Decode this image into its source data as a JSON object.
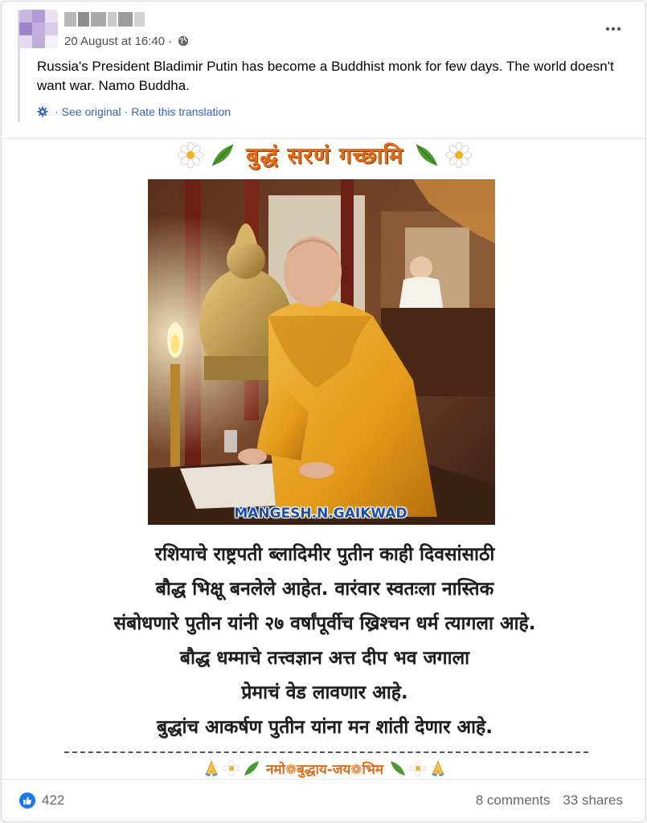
{
  "post": {
    "author_name": "",
    "date": "20 August at 16:40",
    "separator": "·",
    "text": "Russia's President Bladimir Putin has become a Buddhist monk for few days. The world doesn't want war. Namo Buddha.",
    "see_original": "See original",
    "rate_translation": "Rate this translation",
    "translate_separator": "·"
  },
  "graphic": {
    "banner_text": "बुद्धं सरणं गच्छामि",
    "watermark": "MANGESH.N.GAIKWAD",
    "marathi_lines": [
      "रशियाचे राष्ट्रपती ब्लादिमीर पुतीन काही दिवसांसाठी",
      "बौद्ध भिक्षू बनलेले आहेत. वारंवार स्वतःला नास्तिक",
      "संबोधणारे पुतीन यांनी २७  वर्षांपूर्वीच ख्रिश्चन धर्म त्यागला आहे.",
      "बौद्ध धम्माचे तत्त्वज्ञान अत्त दीप भव जगाला",
      "प्रेमाचं वेड लावणार आहे.",
      "बुद्धांच आकर्षण पुतीन यांना मन शांती देणार आहे."
    ],
    "footer_text": "नमो❁बुद्धाय-जय❁भिम"
  },
  "engagement": {
    "reaction_count": "422",
    "comments": "8 comments",
    "shares": "33 shares"
  },
  "icons": {
    "globe": "globe-icon",
    "gear": "gear-icon",
    "more": "more-options-icon",
    "like": "like-icon"
  },
  "colors": {
    "link": "#3266b8",
    "banner_orange": "#e06a16",
    "like_blue": "#1877f2",
    "robe": "#e8a21e"
  }
}
